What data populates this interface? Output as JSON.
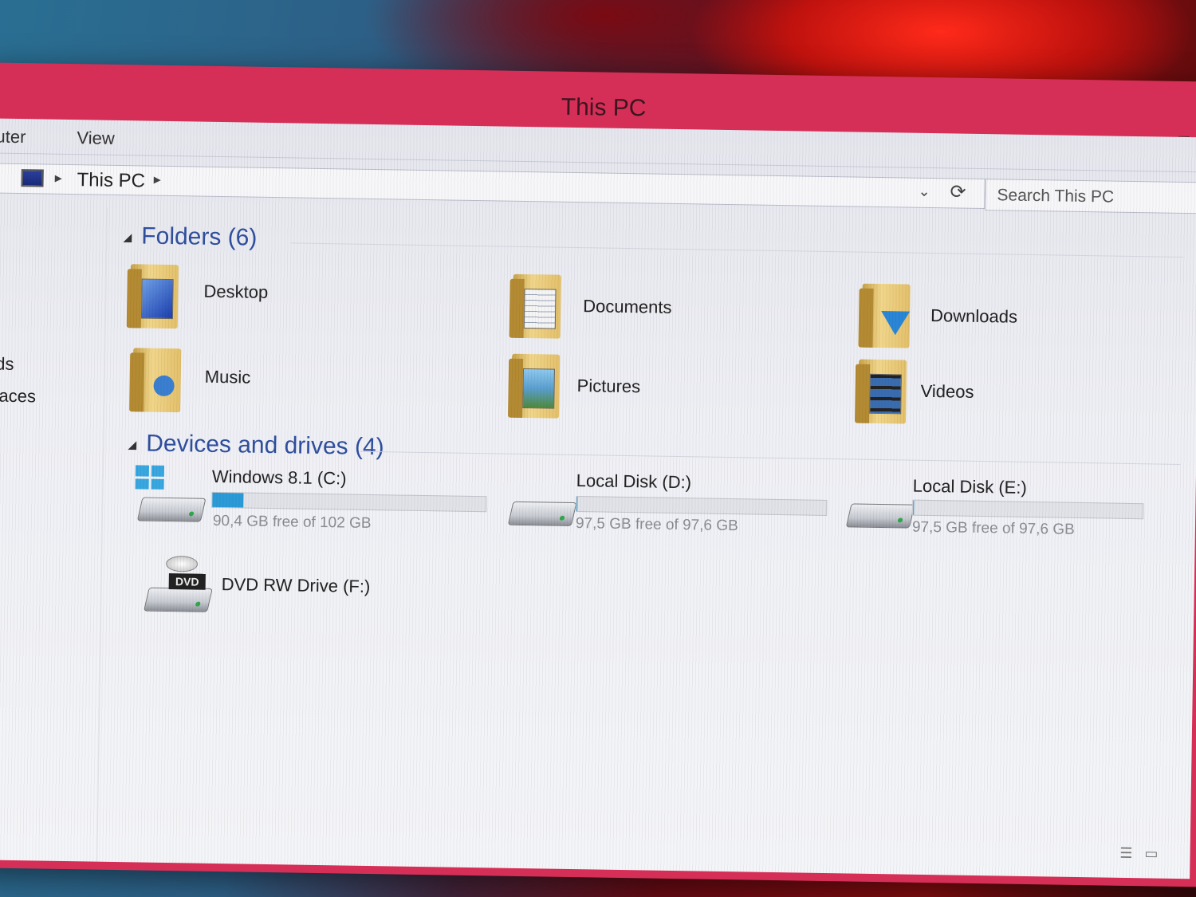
{
  "window": {
    "title": "This PC",
    "minimize_glyph": "–",
    "maximize_glyph": "□"
  },
  "ribbon": {
    "tabs": [
      "uter",
      "View"
    ]
  },
  "address": {
    "location": "This PC",
    "pc_icon": "computer-icon",
    "dropdown_glyph": "⌄",
    "refresh_glyph": "⟳"
  },
  "search": {
    "placeholder": "Search This PC"
  },
  "navpane": {
    "items": [
      "ads",
      "places"
    ]
  },
  "groups": {
    "folders": {
      "title": "Folders (6)"
    },
    "devices": {
      "title": "Devices and drives (4)"
    }
  },
  "folders": [
    {
      "label": "Desktop",
      "icon": "desktop-folder-icon"
    },
    {
      "label": "Documents",
      "icon": "documents-folder-icon"
    },
    {
      "label": "Downloads",
      "icon": "downloads-folder-icon"
    },
    {
      "label": "Music",
      "icon": "music-folder-icon"
    },
    {
      "label": "Pictures",
      "icon": "pictures-folder-icon"
    },
    {
      "label": "Videos",
      "icon": "videos-folder-icon"
    }
  ],
  "drives": [
    {
      "label": "Windows 8.1 (C:)",
      "free": "90,4 GB free of 102 GB",
      "used_fraction": 0.114,
      "icon": "windows-drive-icon"
    },
    {
      "label": "Local Disk (D:)",
      "free": "97,5 GB free of 97,6 GB",
      "used_fraction": 0.001,
      "icon": "hard-drive-icon"
    },
    {
      "label": "Local Disk (E:)",
      "free": "97,5 GB free of 97,6 GB",
      "used_fraction": 0.001,
      "icon": "hard-drive-icon"
    },
    {
      "label": "DVD RW Drive (F:)",
      "icon": "dvd-drive-icon",
      "badge": "DVD"
    }
  ],
  "colors": {
    "title_bar": "#d52f57",
    "group_header": "#2f4f9e",
    "capacity_fill": "#2b9bd8"
  },
  "status_icons": {
    "details_view": "☰",
    "tiles_view": "▭"
  }
}
